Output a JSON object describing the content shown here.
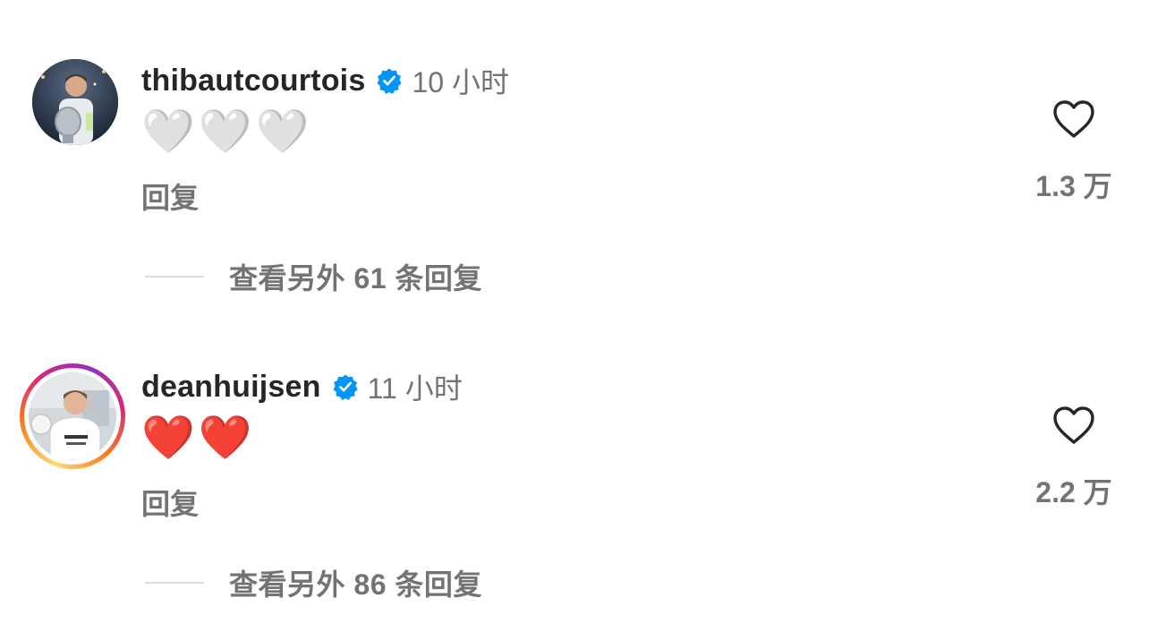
{
  "comments": [
    {
      "username": "thibautcourtois",
      "verified": true,
      "time": "10 小时",
      "body": "🤍🤍🤍",
      "reply_label": "回复",
      "like_count": "1.3 万",
      "view_replies": "查看另外 61 条回复",
      "avatar_icon": "profile-photo-goalkeeper-with-trophy"
    },
    {
      "username": "deanhuijsen",
      "verified": true,
      "time": "11 小时",
      "body": "❤️❤️",
      "reply_label": "回复",
      "like_count": "2.2 万",
      "view_replies": "查看另外 86 条回复",
      "avatar_icon": "profile-photo-player-in-white-kit",
      "has_story_ring": true
    }
  ],
  "colors": {
    "primary_text": "#262626",
    "secondary_text": "#737373",
    "verified_blue": "#0095f6",
    "divider": "#dbdbdb"
  }
}
